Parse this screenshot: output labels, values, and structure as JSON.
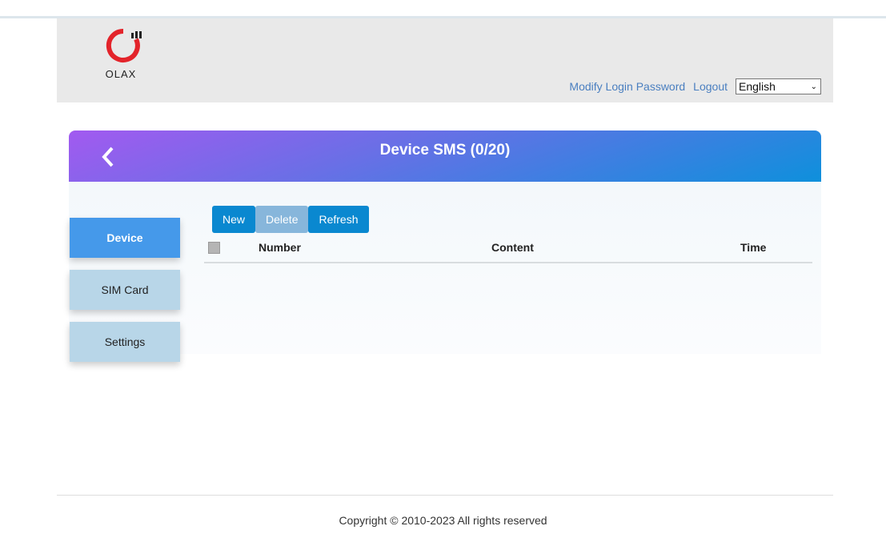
{
  "header": {
    "logo_text": "OLAX",
    "modify_password": "Modify Login Password",
    "logout": "Logout",
    "language": "English"
  },
  "banner": {
    "title": "Device SMS (0/20)"
  },
  "sidebar": {
    "items": [
      {
        "label": "Device"
      },
      {
        "label": "SIM Card"
      },
      {
        "label": "Settings"
      }
    ]
  },
  "toolbar": {
    "new": "New",
    "delete": "Delete",
    "refresh": "Refresh"
  },
  "table": {
    "columns": [
      "Number",
      "Content",
      "Time"
    ]
  },
  "footer": {
    "copyright": "Copyright © 2010-2023 All rights reserved"
  }
}
